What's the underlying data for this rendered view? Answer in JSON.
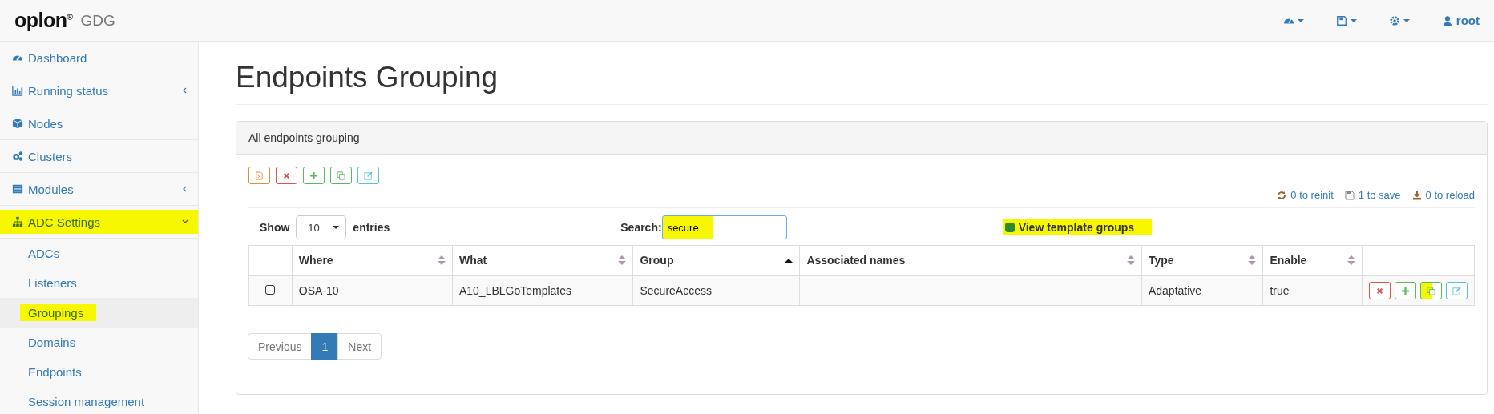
{
  "brand": {
    "logo": "oplon$^{®}$",
    "product": "GDG"
  },
  "top_menus": [
    {
      "kind": "dashboard"
    },
    {
      "kind": "save"
    },
    {
      "kind": "settings"
    },
    {
      "kind": "user",
      "label": "root"
    }
  ],
  "sidebar": {
    "items": [
      {
        "label": "Dashboard",
        "kind": "dashboard"
      },
      {
        "label": "Running status",
        "kind": "chart",
        "expanded": false
      },
      {
        "label": "Nodes",
        "kind": "cube"
      },
      {
        "label": "Clusters",
        "kind": "gears"
      },
      {
        "label": "Modules",
        "kind": "list",
        "expanded": false
      },
      {
        "label": "ADC Settings",
        "kind": "sitemap",
        "expanded": true,
        "highlighted": true,
        "children": [
          {
            "label": "ADCs",
            "selected": false,
            "highlighted": false
          },
          {
            "label": "Listeners",
            "selected": false,
            "highlighted": false
          },
          {
            "label": "Groupings",
            "selected": true,
            "highlighted": true
          },
          {
            "label": "Domains",
            "selected": false,
            "highlighted": false
          },
          {
            "label": "Endpoints",
            "selected": false,
            "highlighted": false
          },
          {
            "label": "Session management",
            "selected": false,
            "highlighted": false
          }
        ]
      }
    ]
  },
  "page_title": "Endpoints Grouping",
  "panel": {
    "heading": "All endpoints grouping",
    "toolbar": [
      {
        "kind": "export",
        "color": "#e08e3c"
      },
      {
        "kind": "delete",
        "color": "#d9534f"
      },
      {
        "kind": "add",
        "color": "#5cb85c"
      },
      {
        "kind": "copy",
        "color": "#5cb85c"
      },
      {
        "kind": "edit",
        "color": "#5bc0de"
      }
    ],
    "status_links": [
      {
        "kind": "reinit",
        "label": "0 to reinit"
      },
      {
        "kind": "save",
        "label": "1 to save"
      },
      {
        "kind": "reload",
        "label": "0 to reload"
      }
    ],
    "length": {
      "prefix": "Show",
      "value": "10",
      "suffix": "entries"
    },
    "search": {
      "label": "Search:",
      "value": "secure",
      "highlighted": true
    },
    "template_toggle": {
      "label": "View template groups",
      "checked": true,
      "highlighted": true
    },
    "table": {
      "columns": [
        {
          "label": "Where",
          "sorted": false
        },
        {
          "label": "What",
          "sorted": false
        },
        {
          "label": "Group",
          "sorted": true
        },
        {
          "label": "Associated names",
          "sorted": false
        },
        {
          "label": "Type",
          "sorted": false
        },
        {
          "label": "Enable",
          "sorted": false
        }
      ],
      "rows": [
        {
          "checked": false,
          "cells": [
            "OSA-10",
            "A10_LBLGoTemplates",
            "SecureAccess",
            "",
            "Adaptative",
            "true"
          ],
          "actions": [
            {
              "kind": "delete",
              "color": "#d9534f",
              "highlighted": false
            },
            {
              "kind": "add",
              "color": "#5cb85c",
              "highlighted": false
            },
            {
              "kind": "copy",
              "color": "#5cb85c",
              "highlighted": true
            },
            {
              "kind": "edit",
              "color": "#5bc0de",
              "highlighted": false
            }
          ]
        }
      ]
    },
    "pagination": [
      {
        "label": "Previous",
        "selected": false
      },
      {
        "label": "1",
        "selected": true
      },
      {
        "label": "Next",
        "selected": false
      }
    ]
  }
}
